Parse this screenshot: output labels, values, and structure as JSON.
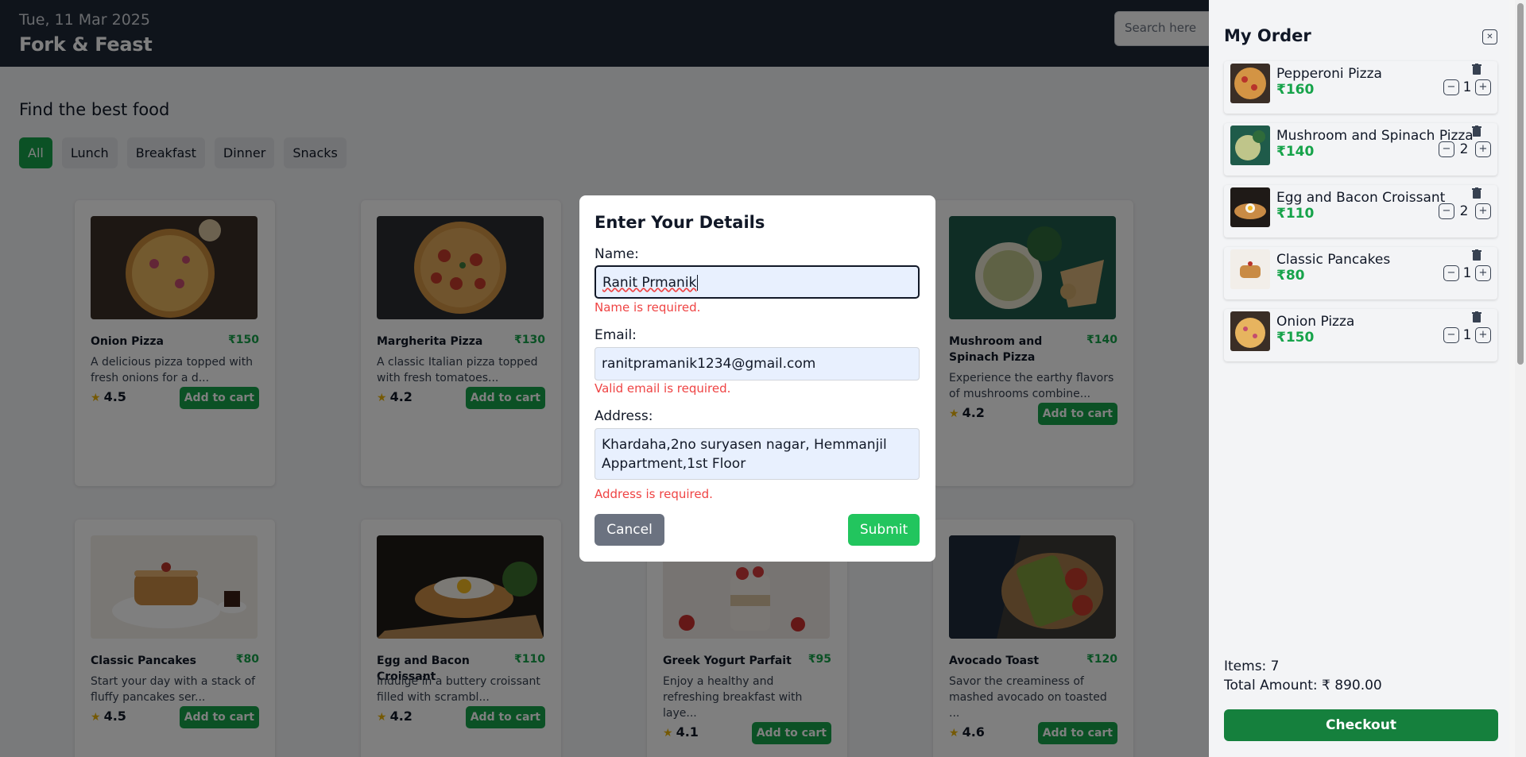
{
  "header": {
    "date": "Tue, 11 Mar 2025",
    "brand": "Fork & Feast",
    "search_placeholder": "Search here"
  },
  "main": {
    "title": "Find the best food",
    "filters": [
      "All",
      "Lunch",
      "Breakfast",
      "Dinner",
      "Snacks"
    ],
    "active_filter": "All",
    "add_label": "Add to cart",
    "cards": [
      {
        "name": "Onion Pizza",
        "price": "₹150",
        "desc": "A delicious pizza topped with fresh onions for a d...",
        "rating": "4.5"
      },
      {
        "name": "Margherita Pizza",
        "price": "₹130",
        "desc": "A classic Italian pizza topped with fresh tomatoes...",
        "rating": "4.2"
      },
      {
        "name": "Mushroom and Spinach Pizza",
        "price": "₹140",
        "desc": "Experience the earthy flavors of mushrooms combine...",
        "rating": "4.2"
      },
      {
        "name": "Classic Pancakes",
        "price": "₹80",
        "desc": "Start your day with a stack of fluffy pancakes ser...",
        "rating": "4.5"
      },
      {
        "name": "Egg and Bacon Croissant",
        "price": "₹110",
        "desc": "Indulge in a buttery croissant filled with scrambl...",
        "rating": "4.2"
      },
      {
        "name": "Greek Yogurt Parfait",
        "price": "₹95",
        "desc": "Enjoy a healthy and refreshing breakfast with laye...",
        "rating": "4.1"
      },
      {
        "name": "Avocado Toast",
        "price": "₹120",
        "desc": "Savor the creaminess of mashed avocado on toasted ...",
        "rating": "4.6"
      }
    ]
  },
  "modal": {
    "title": "Enter Your Details",
    "name_label": "Name:",
    "name_value": "Ranit Prmanik",
    "name_error": "Name is required.",
    "email_label": "Email:",
    "email_value": "ranitpramanik1234@gmail.com",
    "email_error": "Valid email is required.",
    "address_label": "Address:",
    "address_value": "Khardaha,2no suryasen nagar, Hemmanjil Appartment,1st Floor",
    "address_error": "Address is required.",
    "cancel_label": "Cancel",
    "submit_label": "Submit"
  },
  "order": {
    "title": "My Order",
    "close_icon": "close-icon",
    "items": [
      {
        "name": "Pepperoni Pizza",
        "price": "₹160",
        "qty": "1"
      },
      {
        "name": "Mushroom and Spinach Pizza",
        "price": "₹140",
        "qty": "2"
      },
      {
        "name": "Egg and Bacon Croissant",
        "price": "₹110",
        "qty": "2"
      },
      {
        "name": "Classic Pancakes",
        "price": "₹80",
        "qty": "1"
      },
      {
        "name": "Onion Pizza",
        "price": "₹150",
        "qty": "1"
      }
    ],
    "items_count": "Items: 7",
    "total": "Total Amount: ₹ 890.00",
    "checkout_label": "Checkout"
  },
  "colors": {
    "header_bg": "#1f2937",
    "accent_green": "#16a34a",
    "submit_green": "#22c55e",
    "checkout_green": "#15803d",
    "error_red": "#ef4444",
    "star": "#eab308"
  }
}
